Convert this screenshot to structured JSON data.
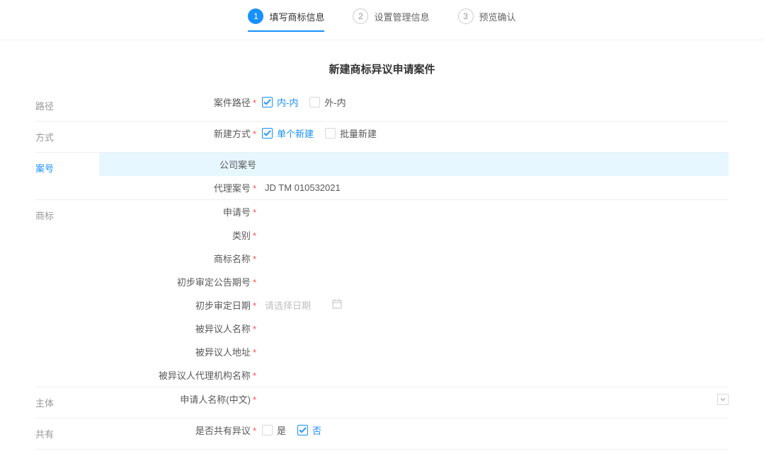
{
  "steps": [
    {
      "num": "1",
      "label": "填写商标信息",
      "active": true
    },
    {
      "num": "2",
      "label": "设置管理信息",
      "active": false
    },
    {
      "num": "3",
      "label": "预览确认",
      "active": false
    }
  ],
  "page_title": "新建商标异议申请案件",
  "sections": {
    "path": {
      "label": "路径",
      "field_label": "案件路径",
      "options": [
        {
          "label": "内-内",
          "checked": true
        },
        {
          "label": "外-内",
          "checked": false
        }
      ]
    },
    "method": {
      "label": "方式",
      "field_label": "新建方式",
      "options": [
        {
          "label": "单个新建",
          "checked": true
        },
        {
          "label": "批量新建",
          "checked": false
        }
      ]
    },
    "case_no": {
      "label": "案号",
      "company_label": "公司案号",
      "agent_label": "代理案号",
      "agent_value": "JD TM 010532021"
    },
    "trademark": {
      "label": "商标",
      "fields": {
        "app_no": "申请号",
        "category": "类别",
        "tm_name": "商标名称",
        "announce_no": "初步审定公告期号",
        "review_date": "初步审定日期",
        "review_date_placeholder": "请选择日期",
        "opposed_name": "被异议人名称",
        "opposed_addr": "被异议人地址",
        "opposed_agent": "被异议人代理机构名称"
      }
    },
    "subject": {
      "label": "主体",
      "field_label": "申请人名称(中文)"
    },
    "shared": {
      "label": "共有",
      "field_label": "是否共有异议",
      "options": [
        {
          "label": "是",
          "checked": false
        },
        {
          "label": "否",
          "checked": true
        }
      ]
    }
  }
}
